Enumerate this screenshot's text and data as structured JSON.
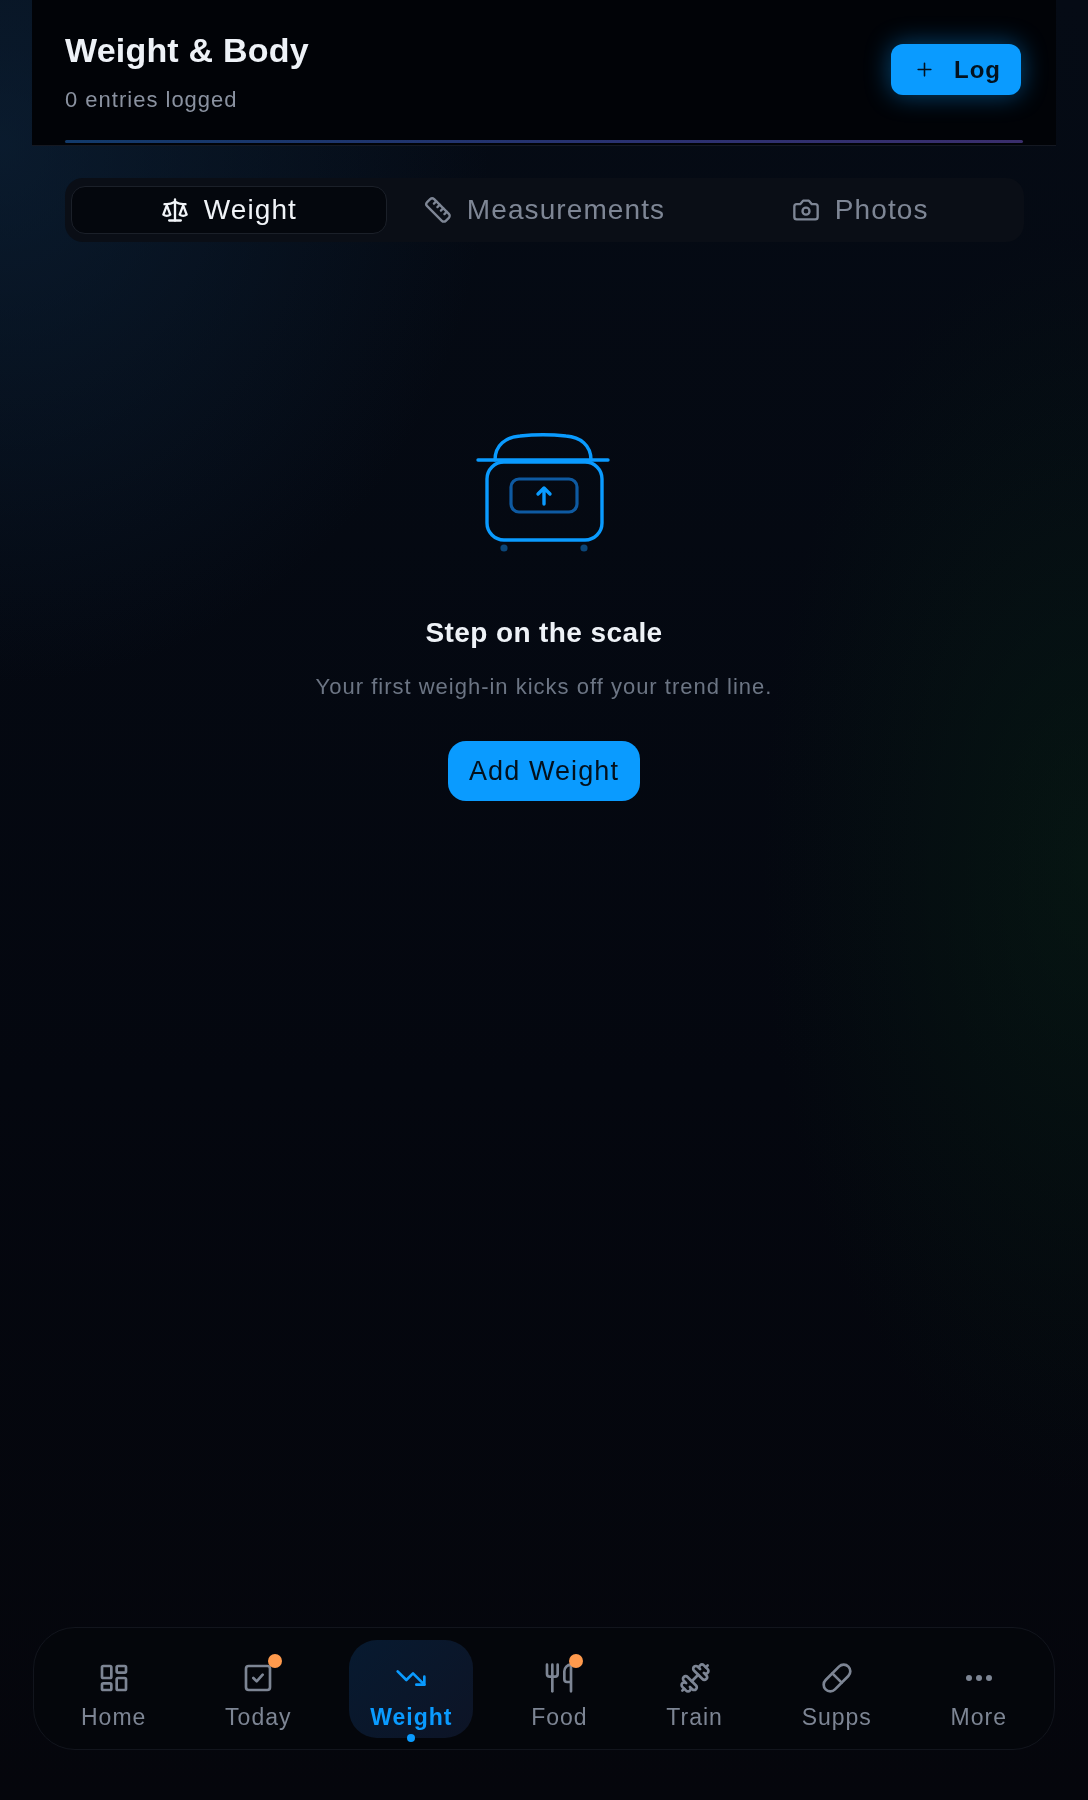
{
  "header": {
    "title": "Weight & Body",
    "subtitle": "0 entries logged",
    "log_button": "Log"
  },
  "tabs": [
    {
      "label": "Weight",
      "selected": true
    },
    {
      "label": "Measurements",
      "selected": false
    },
    {
      "label": "Photos",
      "selected": false
    }
  ],
  "empty_state": {
    "title": "Step on the scale",
    "message": "Your first weigh-in kicks off your trend line.",
    "button": "Add Weight"
  },
  "bottom_nav": [
    {
      "label": "Home",
      "selected": false,
      "notification": false
    },
    {
      "label": "Today",
      "selected": false,
      "notification": true
    },
    {
      "label": "Weight",
      "selected": true,
      "notification": false
    },
    {
      "label": "Food",
      "selected": false,
      "notification": true
    },
    {
      "label": "Train",
      "selected": false,
      "notification": false
    },
    {
      "label": "Supps",
      "selected": false,
      "notification": false
    },
    {
      "label": "More",
      "selected": false,
      "notification": false
    }
  ]
}
